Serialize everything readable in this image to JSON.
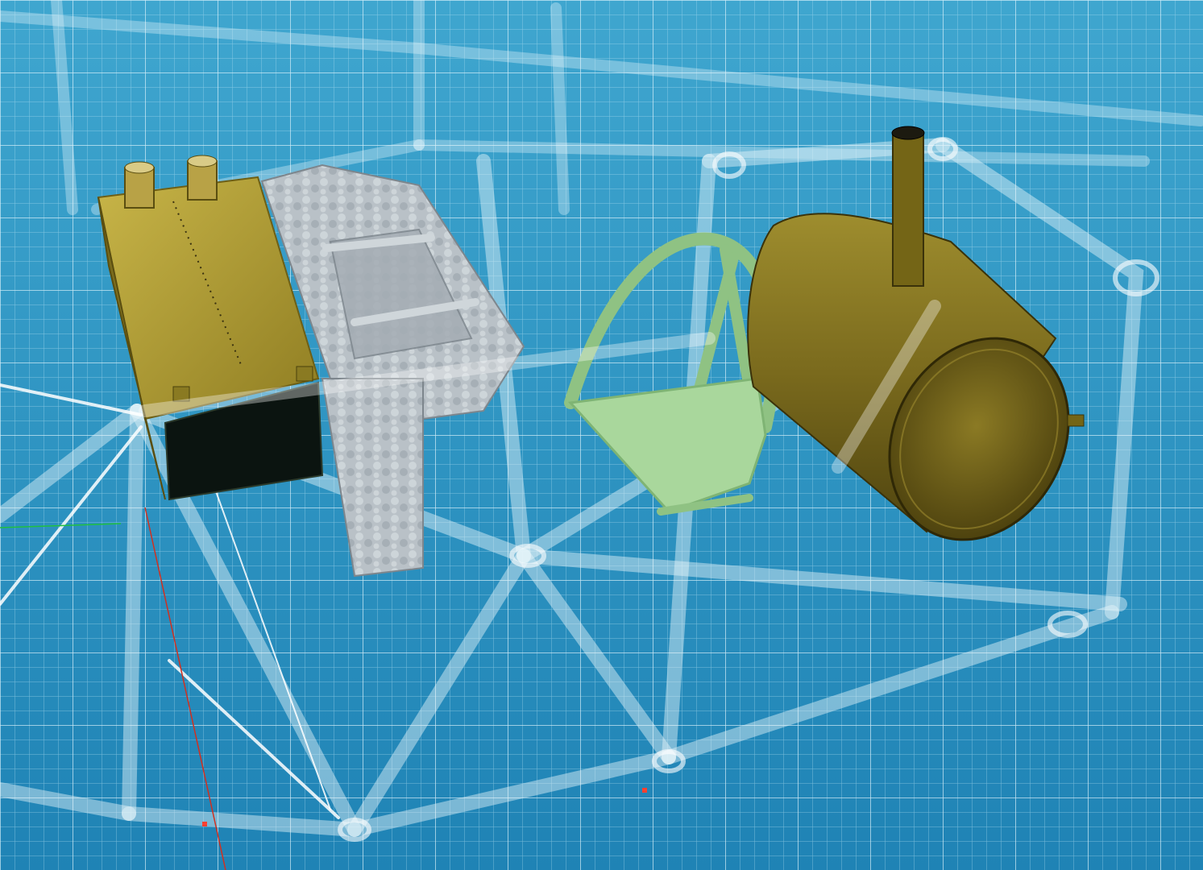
{
  "viewport": {
    "background_color": "#2f8fb8",
    "grid_color": "#bfe6f5",
    "frame_color": "#e8f6fb",
    "axis_x_color": "#d03020",
    "axis_y_color": "#20c040"
  },
  "scene_objects": [
    {
      "name": "fuel-tank",
      "kind": "box-tank-with-two-caps",
      "color": "#a8952c"
    },
    {
      "name": "seat-frame",
      "kind": "hammered-metal-seat-frame",
      "color": "#b7bec4"
    },
    {
      "name": "pilot-seat",
      "kind": "tubular-bucket-seat",
      "color": "#a9d79c"
    },
    {
      "name": "oil-tank",
      "kind": "cylinder-tank-with-filler-neck",
      "color": "#7d6e1e"
    },
    {
      "name": "fuselage-truss",
      "kind": "transparent-tube-frame",
      "color": "#e8f6fb"
    }
  ]
}
